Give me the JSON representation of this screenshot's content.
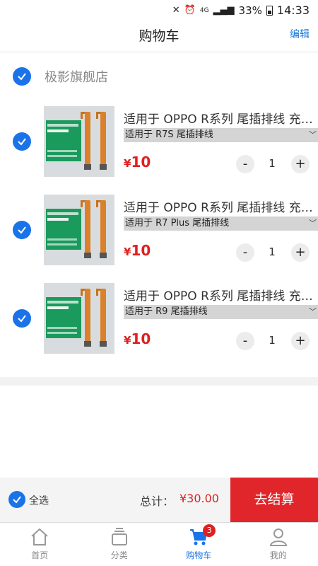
{
  "status_bar": {
    "battery": "33%",
    "time": "14:33",
    "network": "4G"
  },
  "header": {
    "title": "购物车",
    "edit_label": "编辑"
  },
  "shop": {
    "name": "极影旗舰店",
    "selected": true
  },
  "items": [
    {
      "title": "适用于 OPPO R系列 尾插排线 充电口 送话器",
      "variant": "适用于 R7S 尾插排线",
      "price_symbol": "¥",
      "price": "10",
      "quantity": "1",
      "selected": true
    },
    {
      "title": "适用于 OPPO R系列 尾插排线 充电口 送话器",
      "variant": "适用于 R7 Plus 尾插排线",
      "price_symbol": "¥",
      "price": "10",
      "quantity": "1",
      "selected": true
    },
    {
      "title": "适用于 OPPO R系列 尾插排线 充电口 送话器",
      "variant": "适用于 R9 尾插排线",
      "price_symbol": "¥",
      "price": "10",
      "quantity": "1",
      "selected": true
    }
  ],
  "footer": {
    "select_all_label": "全选",
    "total_label": "总计：",
    "total_value": "¥30.00",
    "checkout_label": "去结算"
  },
  "tabs": [
    {
      "label": "首页",
      "icon": "home-icon",
      "active": false
    },
    {
      "label": "分类",
      "icon": "category-icon",
      "active": false
    },
    {
      "label": "购物车",
      "icon": "cart-icon",
      "active": true,
      "badge": "3"
    },
    {
      "label": "我的",
      "icon": "user-icon",
      "active": false
    }
  ],
  "colors": {
    "accent": "#1a73e8",
    "price": "#e02020",
    "checkout": "#e0262a"
  },
  "stepper": {
    "minus": "-",
    "plus": "+"
  }
}
